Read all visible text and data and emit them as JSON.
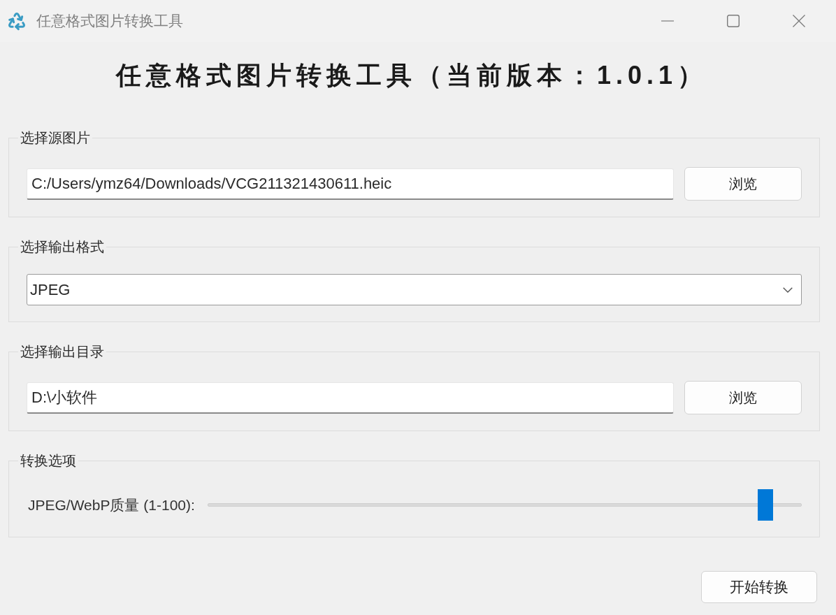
{
  "window": {
    "title": "任意格式图片转换工具"
  },
  "heading": "任意格式图片转换工具（当前版本：1.0.1）",
  "groups": [
    {
      "kind": "file",
      "title": "选择源图片",
      "value": "C:/Users/ymz64/Downloads/VCG211321430611.heic",
      "button": "浏览"
    },
    {
      "kind": "select",
      "title": "选择输出格式",
      "value": "JPEG"
    },
    {
      "kind": "file",
      "title": "选择输出目录",
      "value": "D:\\小软件",
      "button": "浏览"
    },
    {
      "kind": "slider",
      "title": "转换选项",
      "label": "JPEG/WebP质量 (1-100):",
      "level": 0.95
    }
  ],
  "start_button": "开始转换"
}
